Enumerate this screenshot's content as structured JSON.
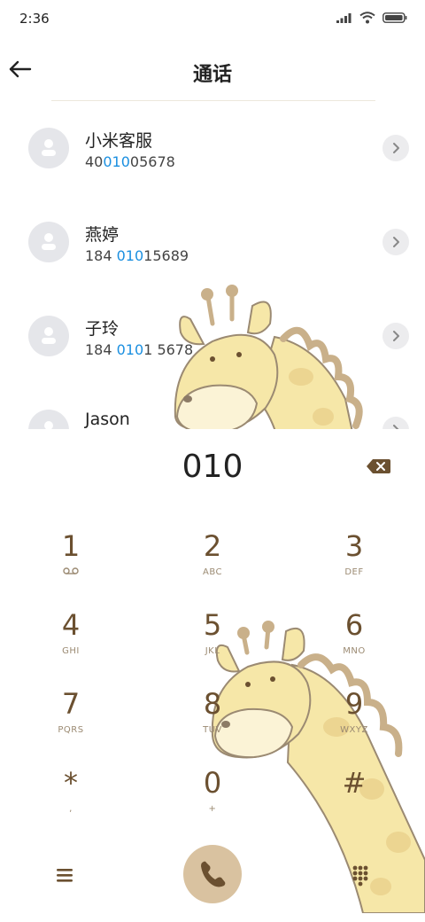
{
  "status": {
    "time": "2:36"
  },
  "header": {
    "title": "通话"
  },
  "contacts": [
    {
      "name": "小米客服",
      "number_pre": "40",
      "number_match": "010",
      "number_post": "05678"
    },
    {
      "name": "燕婷",
      "number_pre": "184 ",
      "number_match": "010",
      "number_post": "15689"
    },
    {
      "name": "子玲",
      "number_pre": "184 ",
      "number_match": "010",
      "number_post": "1 5678"
    },
    {
      "name": "Jason",
      "number_pre": "",
      "number_match": "",
      "number_post": ""
    }
  ],
  "dial": {
    "input": "010"
  },
  "keypad": [
    {
      "digit": "1",
      "letters": ""
    },
    {
      "digit": "2",
      "letters": "ABC"
    },
    {
      "digit": "3",
      "letters": "DEF"
    },
    {
      "digit": "4",
      "letters": "GHI"
    },
    {
      "digit": "5",
      "letters": "JKL"
    },
    {
      "digit": "6",
      "letters": "MNO"
    },
    {
      "digit": "7",
      "letters": "PQRS"
    },
    {
      "digit": "8",
      "letters": "TUV"
    },
    {
      "digit": "9",
      "letters": "WXYZ"
    },
    {
      "digit": "*",
      "letters": ","
    },
    {
      "digit": "0",
      "letters": "+"
    },
    {
      "digit": "#",
      "letters": ""
    }
  ],
  "icons": {
    "back": "arrow-left-icon",
    "delete": "backspace-icon",
    "menu": "menu-icon",
    "call": "phone-icon",
    "dialpad": "dialpad-icon",
    "voicemail": "voicemail-icon"
  },
  "colors": {
    "accent": "#6b5030",
    "call_button": "#d9c2a0",
    "match_highlight": "#1a8fe0"
  }
}
